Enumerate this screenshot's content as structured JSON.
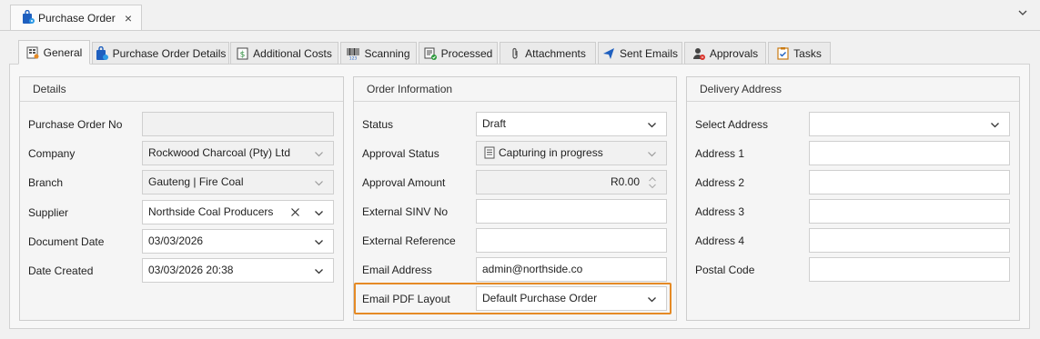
{
  "document_tab": {
    "title": "Purchase Order",
    "close": "×"
  },
  "tabs": [
    {
      "label": "General"
    },
    {
      "label": "Purchase Order Details"
    },
    {
      "label": "Additional Costs"
    },
    {
      "label": "Scanning"
    },
    {
      "label": "Processed"
    },
    {
      "label": "Attachments"
    },
    {
      "label": "Sent Emails"
    },
    {
      "label": "Approvals"
    },
    {
      "label": "Tasks"
    }
  ],
  "details": {
    "title": "Details",
    "purchase_order_no": {
      "label": "Purchase Order No",
      "value": ""
    },
    "company": {
      "label": "Company",
      "value": "Rockwood Charcoal (Pty) Ltd"
    },
    "branch": {
      "label": "Branch",
      "value": "Gauteng | Fire Coal"
    },
    "supplier": {
      "label": "Supplier",
      "value": "Northside Coal Producers"
    },
    "document_date": {
      "label": "Document Date",
      "value": "03/03/2026"
    },
    "date_created": {
      "label": "Date Created",
      "value": "03/03/2026 20:38"
    }
  },
  "order_info": {
    "title": "Order Information",
    "status": {
      "label": "Status",
      "value": "Draft"
    },
    "approval_status": {
      "label": "Approval Status",
      "value": "Capturing in progress"
    },
    "approval_amount": {
      "label": "Approval Amount",
      "value": "R0.00"
    },
    "external_sinv_no": {
      "label": "External SINV No",
      "value": ""
    },
    "external_reference": {
      "label": "External Reference",
      "value": ""
    },
    "email_address": {
      "label": "Email Address",
      "value": "admin@northside.co"
    },
    "email_pdf_layout": {
      "label": "Email PDF Layout",
      "value": "Default Purchase Order"
    }
  },
  "delivery": {
    "title": "Delivery Address",
    "select_address": {
      "label": "Select Address",
      "value": ""
    },
    "address1": {
      "label": "Address 1",
      "value": ""
    },
    "address2": {
      "label": "Address 2",
      "value": ""
    },
    "address3": {
      "label": "Address 3",
      "value": ""
    },
    "address4": {
      "label": "Address 4",
      "value": ""
    },
    "postal_code": {
      "label": "Postal Code",
      "value": ""
    }
  },
  "colors": {
    "highlight": "#e58a25",
    "accent": "#1e6fd9"
  }
}
